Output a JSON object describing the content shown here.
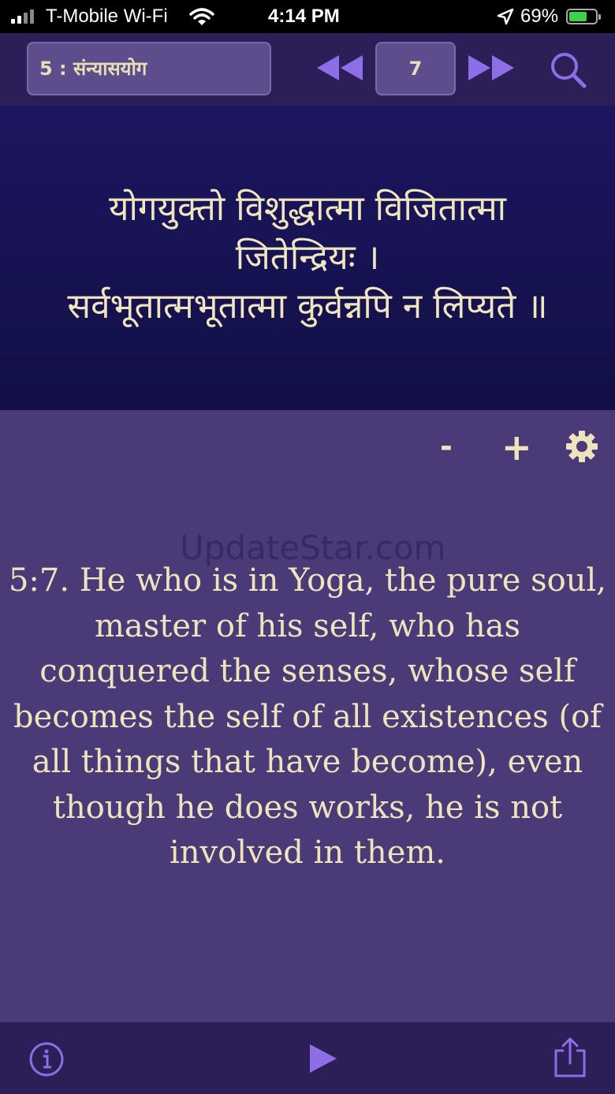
{
  "status_bar": {
    "carrier": "T-Mobile Wi-Fi",
    "time": "4:14 PM",
    "battery": "69%",
    "icons": [
      "signal-icon",
      "wifi-icon",
      "location-arrow-icon",
      "battery-charging-icon"
    ]
  },
  "toolbar": {
    "chapter_label": "5 : संन्यासयोग",
    "verse_number": "7",
    "icons": [
      "rewind-icon",
      "fast-forward-icon",
      "search-icon"
    ]
  },
  "sanskrit": {
    "verse": "योगयुक्तो विशुद्धात्मा विजितात्मा\nजितेन्द्रियः ।\nसर्वभूतात्मभूतात्मा कुर्वन्नपि न लिप्यते ॥"
  },
  "controls": {
    "decrease_label": "-",
    "increase_label": "+",
    "icons": [
      "gear-icon"
    ]
  },
  "watermark": "UpdateStar.com",
  "translation": "5:7. He who is in Yoga, the pure soul, master of his self, who has conquered the senses, whose self becomes the self of all existences (of all things that have become), even though he does works, he is not involved in them.",
  "bottom_bar": {
    "icons": [
      "info-icon",
      "play-icon",
      "share-icon"
    ]
  },
  "colors": {
    "accent": "#8d6ee6",
    "text": "#eee3bd",
    "background": "#4b3a78",
    "panel": "#1c1660",
    "toolbar": "#2c1f58"
  }
}
